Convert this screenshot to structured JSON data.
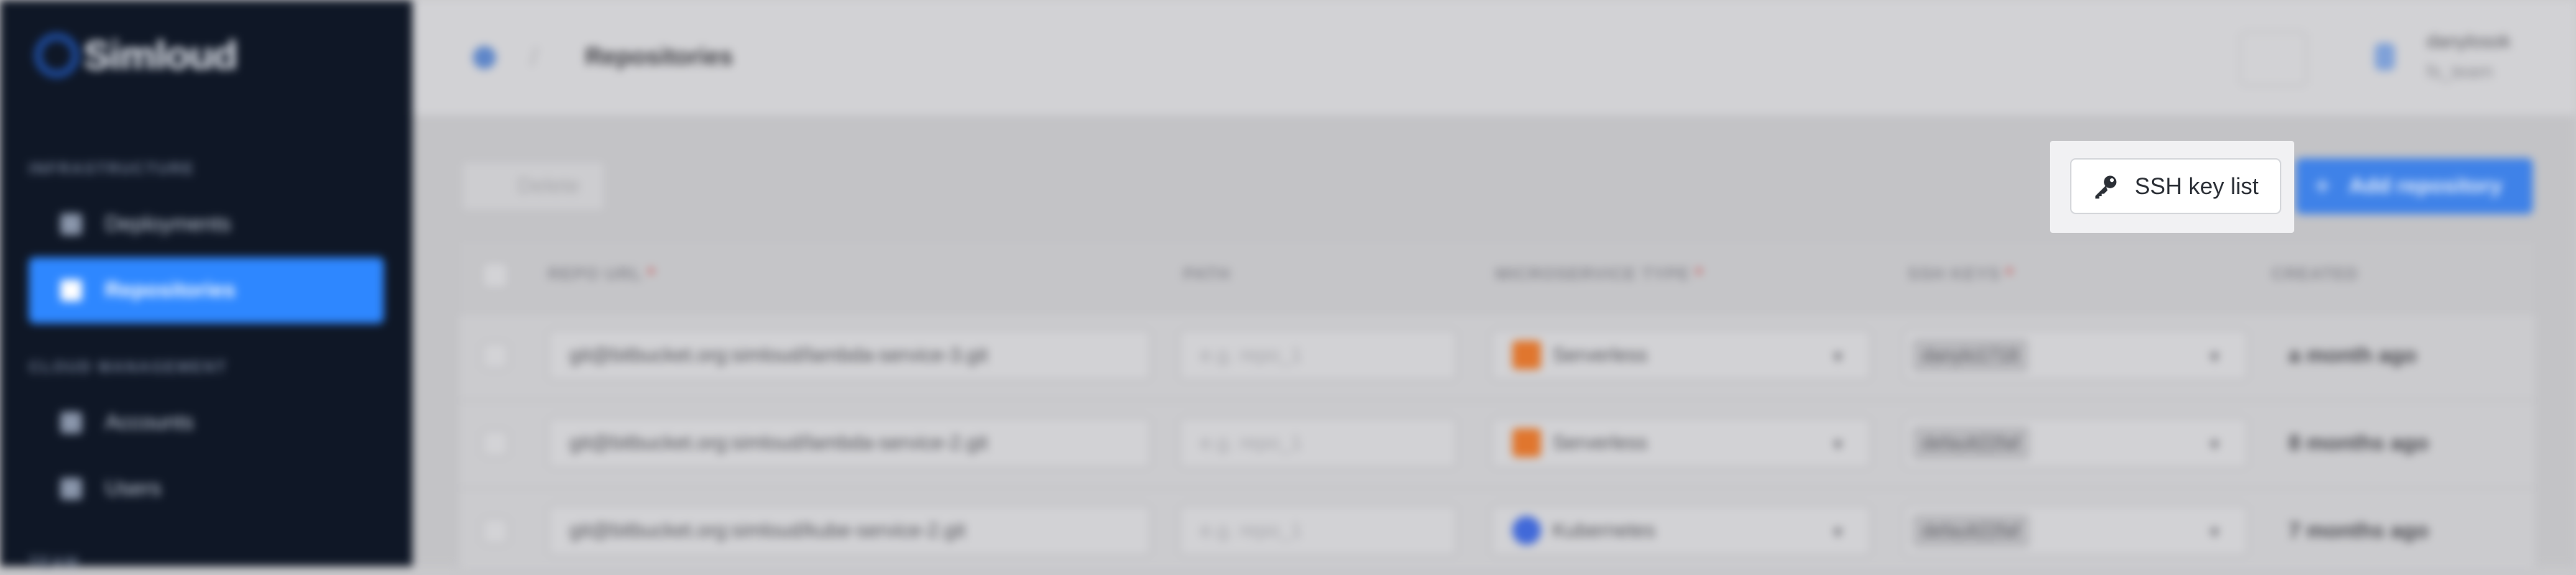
{
  "app": {
    "name": "Simloud"
  },
  "sidebar": {
    "sections": [
      {
        "label": "INFRASTRUCTURE"
      },
      {
        "label": "CLOUD MANAGEMENT"
      },
      {
        "label": "TEAM"
      }
    ],
    "items": [
      {
        "label": "Deployments",
        "icon": "grid-icon"
      },
      {
        "label": "Repositories",
        "icon": "document-icon",
        "active": true
      },
      {
        "label": "Accounts",
        "icon": "accounts-icon"
      },
      {
        "label": "Users",
        "icon": "user-icon"
      }
    ]
  },
  "header": {
    "title": "Repositories",
    "separator": "/",
    "user": {
      "name": "danylosok",
      "team": "fs_team"
    }
  },
  "toolbar": {
    "delete_label": "Delete",
    "ssh_key_list_label": "SSH key list",
    "add_repository_label": "Add repository"
  },
  "table": {
    "columns": [
      {
        "label": "REPO URL",
        "required": "*"
      },
      {
        "label": "PATH"
      },
      {
        "label": "MICROSERVICE TYPE",
        "required": "*"
      },
      {
        "label": "SSH KEYS",
        "required": "*"
      },
      {
        "label": "CREATED"
      }
    ],
    "path_placeholder": "e.g. repo_1",
    "rows": [
      {
        "repo_url": "git@bitbucket.org:simloud/lambda-service-3.git",
        "type": "Serverless",
        "type_color": "#e0762e",
        "ssh_key": "danylo1718",
        "created": "a month ago"
      },
      {
        "repo_url": "git@bitbucket.org:simloud/lambda-service-2.git",
        "type": "Serverless",
        "type_color": "#e0762e",
        "ssh_key": "default22faf",
        "created": "8 months ago"
      },
      {
        "repo_url": "git@bitbucket.org:simloud/kube-service-2.git",
        "type": "Kubernetes",
        "type_color": "#4169d9",
        "ssh_key": "default22faf",
        "created": "7 months ago"
      }
    ]
  }
}
